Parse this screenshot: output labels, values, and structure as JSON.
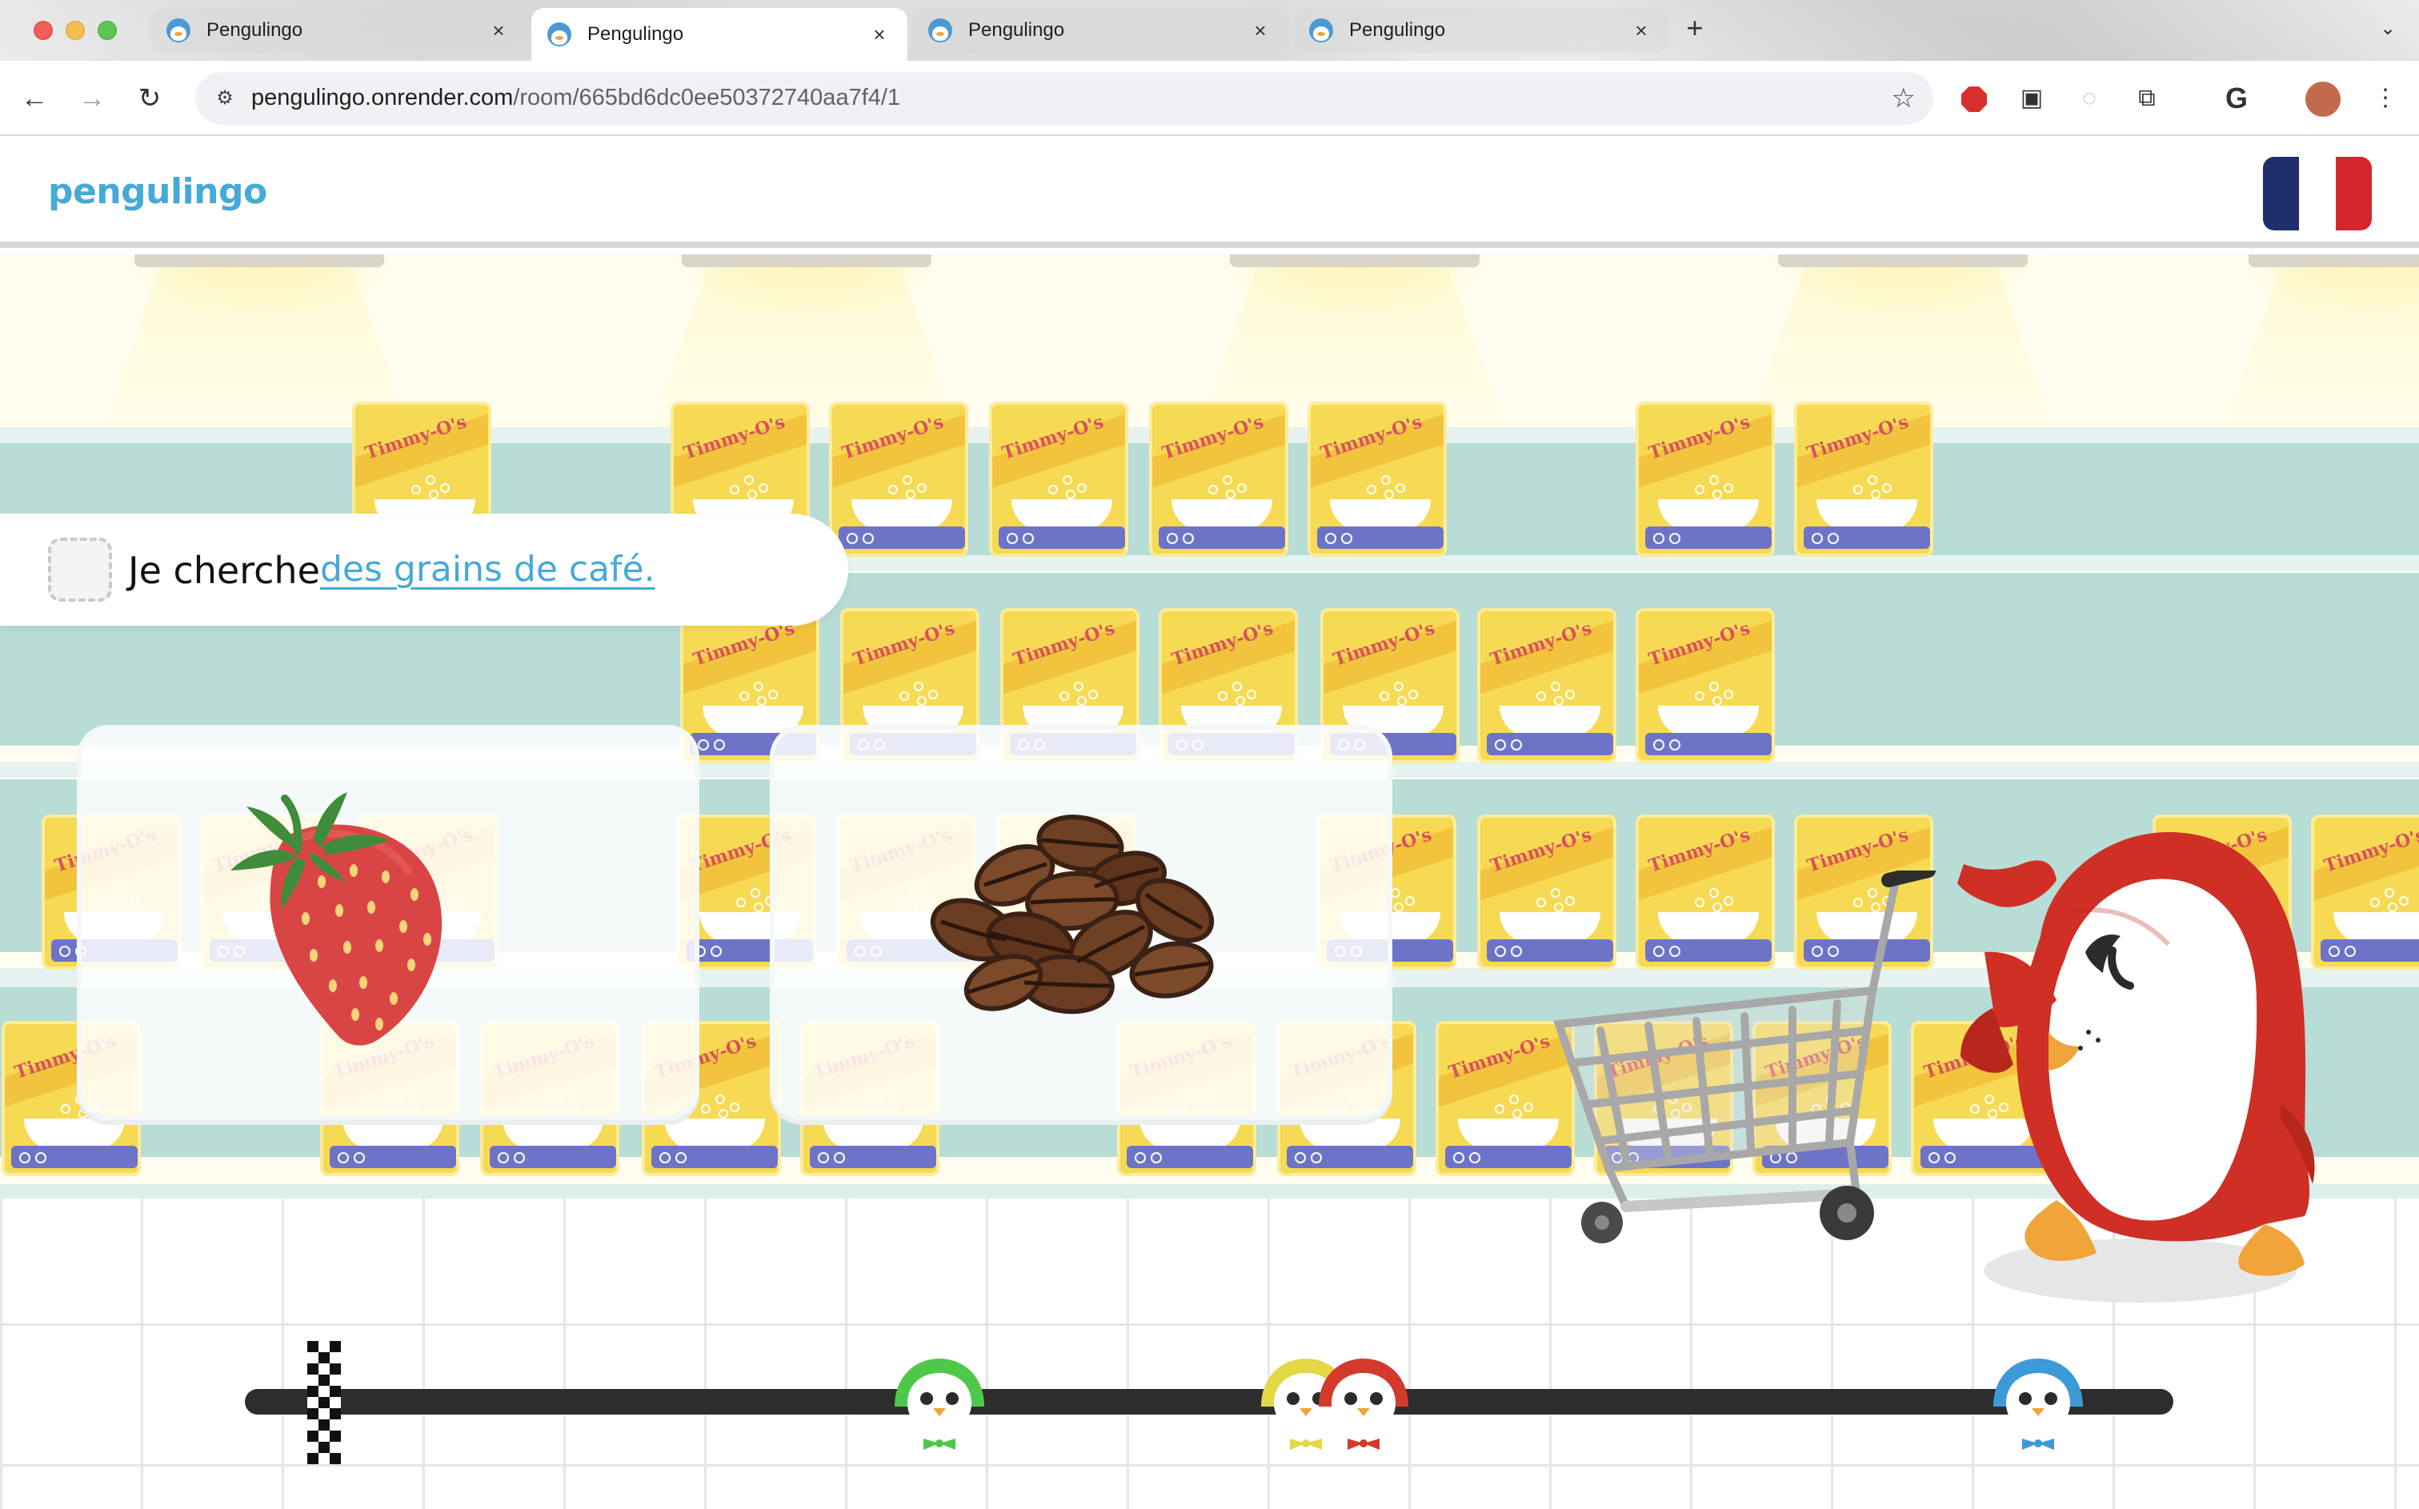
{
  "browser": {
    "tabs": [
      {
        "title": "Pengulingo",
        "active": false
      },
      {
        "title": "Pengulingo",
        "active": true
      },
      {
        "title": "Pengulingo",
        "active": false
      },
      {
        "title": "Pengulingo",
        "active": false
      }
    ],
    "url_host": "pengulingo.onrender.com",
    "url_path": "/room/665bd6dc0ee50372740aa7f4/1",
    "icons": {
      "back": "←",
      "forward": "→",
      "reload": "↻",
      "new_tab": "+",
      "tab_close": "×",
      "tab_menu": "⌄",
      "site_info": "⚙",
      "bookmark": "☆",
      "picture_in_picture": "▣",
      "extensions": "⧉",
      "google": "G",
      "menu": "⋮",
      "extension_circle": "◌"
    }
  },
  "app": {
    "logo": "pengulingo",
    "flag_colors": [
      "#1f2f6b",
      "#ffffff",
      "#d3272b"
    ],
    "prompt": {
      "lead": "Je cherche",
      "target": "des grains de café."
    },
    "choices": [
      {
        "item": "strawberry-icon"
      },
      {
        "item": "coffee-beans-icon"
      }
    ],
    "shelf_brand": "Timmy-O's",
    "progress": {
      "racers": [
        {
          "color": "green",
          "hex": "#4fc84a",
          "progress": 0.36
        },
        {
          "color": "yellow",
          "hex": "#e4d846",
          "progress": 0.55
        },
        {
          "color": "red",
          "hex": "#d33a2c",
          "progress": 0.58
        },
        {
          "color": "blue",
          "hex": "#3d9ad8",
          "progress": 0.93
        }
      ]
    }
  }
}
